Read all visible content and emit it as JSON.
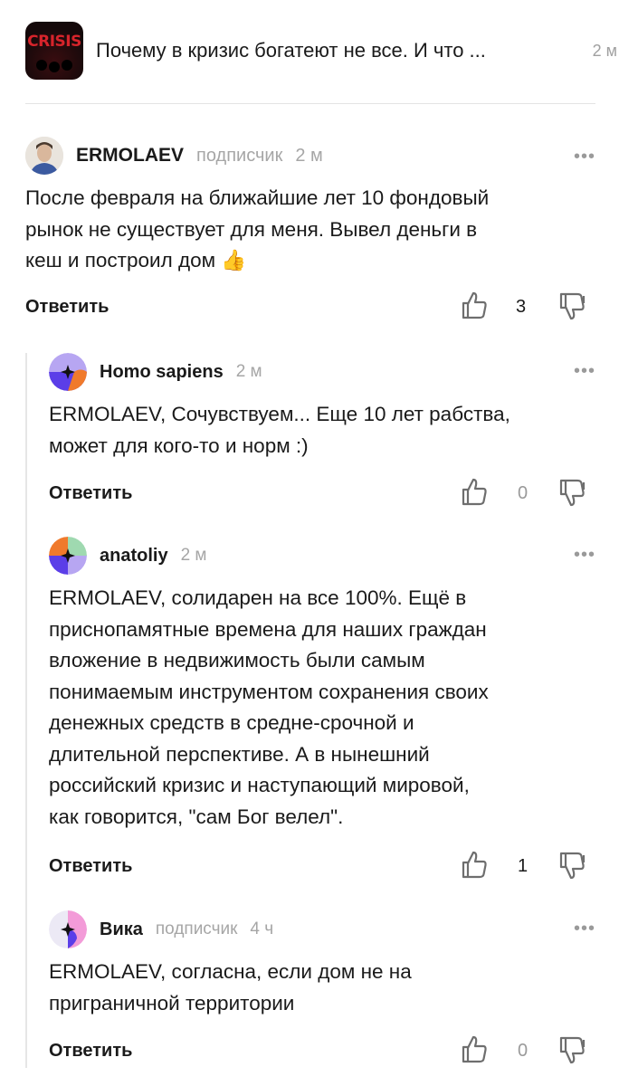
{
  "article": {
    "thumb_text": "CRISIS",
    "title": "Почему в кризис богатеют не все. И что ...",
    "time": "2 м"
  },
  "comments": [
    {
      "author": "ERMOLAEV",
      "badge": "подписчик",
      "time": "2 м",
      "text_lines": [
        "После февраля на ближайшие лет 10 фондовый",
        "рынок не существует для меня. Вывел деньги в",
        "кеш и построил дом 👍"
      ],
      "reply_label": "Ответить",
      "likes": "3",
      "more": "•••"
    },
    {
      "author": "Homo sapiens",
      "badge": "",
      "time": "2 м",
      "text_lines": [
        "ERMOLAEV, Сочувствуем... Еще 10 лет рабства,",
        "может для кого-то и норм :)"
      ],
      "reply_label": "Ответить",
      "likes": "0",
      "more": "•••"
    },
    {
      "author": "anatoliy",
      "badge": "",
      "time": "2 м",
      "text_lines": [
        "ERMOLAEV, солидарен на все 100%. Ещё в",
        "приснопамятные времена для наших граждан",
        "вложение в недвижимость были самым",
        "понимаемым инструментом сохранения своих",
        "денежных средств в средне-срочной и",
        "длительной перспективе. А в нынешний",
        "российский кризис и наступающий мировой,",
        "как говорится, \"сам Бог велел\"."
      ],
      "reply_label": "Ответить",
      "likes": "1",
      "more": "•••"
    },
    {
      "author": "Вика",
      "badge": "подписчик",
      "time": "4 ч",
      "text_lines": [
        "ERMOLAEV, согласна, если дом не на",
        "приграничной территории"
      ],
      "reply_label": "Ответить",
      "likes": "0",
      "more": "•••"
    }
  ],
  "colors": {
    "text": "#1a1a1a",
    "muted": "#a6a6a6",
    "thumb_red": "#d6242b",
    "divider": "#e3e3e3"
  },
  "icons": [
    "thumbs-up-icon",
    "thumbs-down-icon",
    "more-icon",
    "avatar-icon"
  ]
}
